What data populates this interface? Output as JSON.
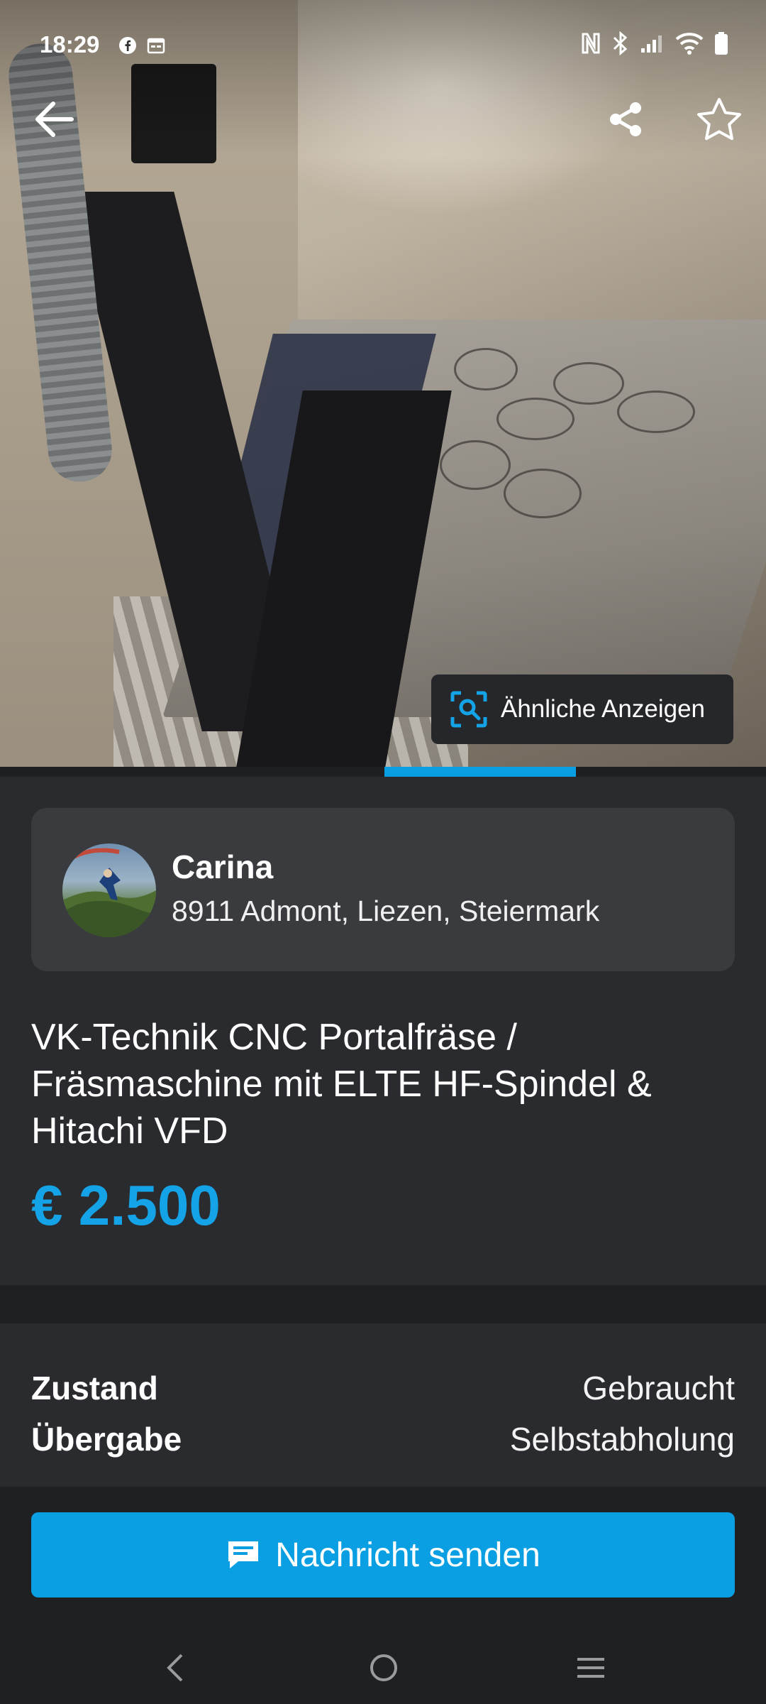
{
  "status_bar": {
    "time": "18:29"
  },
  "hero": {
    "similar_ads_label": "Ähnliche Anzeigen"
  },
  "seller": {
    "name": "Carina",
    "location": "8911 Admont, Liezen, Steiermark"
  },
  "listing": {
    "title": "VK-Technik CNC Portalfräse / Fräsmaschine mit ELTE HF-Spindel & Hitachi VFD",
    "price": "€ 2.500"
  },
  "details": [
    {
      "key": "Zustand",
      "value": "Gebraucht"
    },
    {
      "key": "Übergabe",
      "value": "Selbstabholung"
    }
  ],
  "actions": {
    "send_message": "Nachricht senden"
  },
  "colors": {
    "accent": "#0a9fe3",
    "price": "#14a3e6",
    "background": "#2a2b2e",
    "card": "#3a3b3e"
  },
  "image_carousel": {
    "active_index": 3,
    "count": 5
  }
}
